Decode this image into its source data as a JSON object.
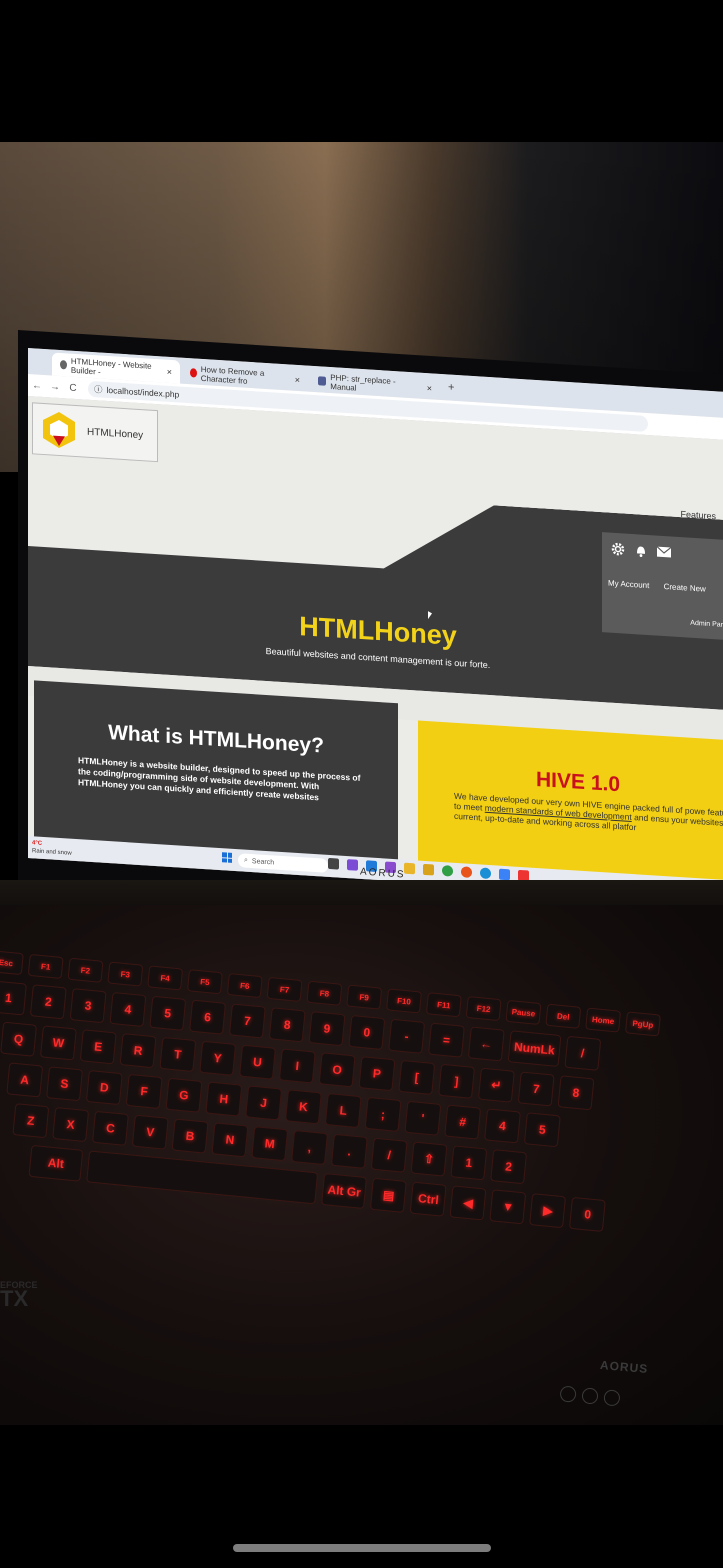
{
  "browser": {
    "tabs": [
      {
        "label": "HTMLHoney - Website Builder -",
        "active": true
      },
      {
        "label": "How to Remove a Character fro",
        "active": false
      },
      {
        "label": "PHP: str_replace - Manual",
        "active": false
      }
    ],
    "tab_close": "×",
    "new_tab": "+",
    "url": "localhost/index.php",
    "nav": {
      "back": "←",
      "forward": "→",
      "reload": "C"
    }
  },
  "site": {
    "logo_text": "HTMLHoney",
    "nav_features": "Features",
    "account_links": [
      "My Account",
      "Create New"
    ],
    "admin_panel": "Admin Panel",
    "hero_title": "HTMLHoney",
    "hero_subtitle": "Beautiful websites and content management is our forte.",
    "card_what": {
      "title": "What is HTMLHoney?",
      "text": "HTMLHoney is a website builder, designed to speed up the process of the coding/programming side of website development. With HTMLHoney you can quickly and efficiently create websites"
    },
    "card_hive": {
      "title": "HIVE 1.0",
      "text_before": "We have developed our very own HIVE engine packed full of powe features to meet",
      "text_link": "modern standards of web development",
      "text_after": "and ensu your websites are current, up-to-date and working across all platfor"
    },
    "colors": {
      "accent_yellow": "#f3d21a",
      "dark": "#3b3b3b",
      "hive_red": "#c8101e"
    }
  },
  "taskbar": {
    "weather_temp": "4°C",
    "weather_desc": "Rain and snow",
    "search_placeholder": "Search"
  },
  "keyboard": {
    "fn_row": [
      "Esc",
      "F1",
      "F2",
      "F3",
      "F4",
      "F5",
      "F6",
      "F7",
      "F8",
      "F9",
      "F10",
      "F11",
      "F12",
      "Pause",
      "Del",
      "Home",
      "PgUp"
    ],
    "num_row": [
      "1",
      "2",
      "3",
      "4",
      "5",
      "6",
      "7",
      "8",
      "9",
      "0",
      "-",
      "=",
      "←",
      "NumLk",
      "/"
    ],
    "q_row": [
      "Q",
      "W",
      "E",
      "R",
      "T",
      "Y",
      "U",
      "I",
      "O",
      "P",
      "[",
      "]",
      "↵",
      "7",
      "8"
    ],
    "a_row": [
      "A",
      "S",
      "D",
      "F",
      "G",
      "H",
      "J",
      "K",
      "L",
      ";",
      "'",
      "#",
      "4",
      "5"
    ],
    "z_row": [
      "Z",
      "X",
      "C",
      "V",
      "B",
      "N",
      "M",
      ",",
      ".",
      "/",
      "⇧",
      "1",
      "2"
    ],
    "bottom_row": [
      "Alt",
      "Alt Gr",
      "▤",
      "Ctrl",
      "◀",
      "▼",
      "▶",
      "0"
    ]
  },
  "laptop": {
    "brand": "AORUS",
    "geforce_line1": "EFORCE",
    "geforce_line2": "TX"
  }
}
